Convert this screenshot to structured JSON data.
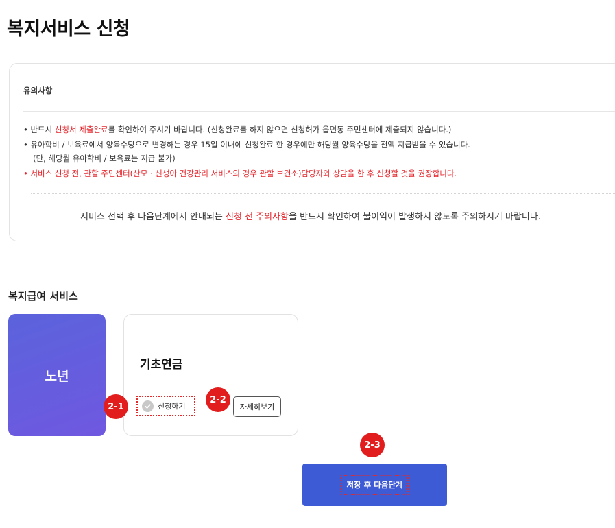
{
  "page": {
    "title": "복지서비스 신청"
  },
  "notice": {
    "title": "유의사항",
    "line1": {
      "prefix": "• 반드시 ",
      "highlight": "신청서 제출완료",
      "suffix": "를 확인하여 주시기 바랍니다. (신청완료를 하지 않으면 신청허가 읍면동 주민센터에 제출되지 않습니다.)"
    },
    "line2": "• 유아학비 / 보육료에서 양육수당으로 변경하는 경우 15일 이내에 신청완료 한 경우에만 해당월 양육수당을 전액 지급받을 수 있습니다.",
    "line2b": "(단, 해당월 유아학비 / 보육료는 지급 불가)",
    "line3": "• 서비스 신청 전, 관할 주민센터(산모 · 신생아 건강관리 서비스의 경우 관할 보건소)담당자와 상담을 한 후 신청할 것을 권장합니다.",
    "footer": {
      "prefix": "서비스 선택 후 다음단계에서 안내되는 ",
      "highlight": "신청 전 주의사항",
      "suffix": "을 반드시 확인하여 불이익이 발생하지 않도록 주의하시기 바랍니다."
    }
  },
  "section": {
    "title": "복지급여 서비스",
    "tiles": [
      {
        "label": "노년"
      },
      {
        "label": "기초연금",
        "apply_label": "신청하기",
        "detail_label": "자세히보기"
      }
    ]
  },
  "annotations": [
    "2-1",
    "2-2",
    "2-3"
  ],
  "actions": {
    "next_label": "저장 후 다음단계"
  },
  "colors": {
    "accent_red": "#e4262c",
    "tile_blue": "#5b63dc",
    "button_blue": "#3e5bd6",
    "badge_red": "#e21d1d"
  },
  "icons": {
    "apply_check": "check-circle-icon"
  }
}
